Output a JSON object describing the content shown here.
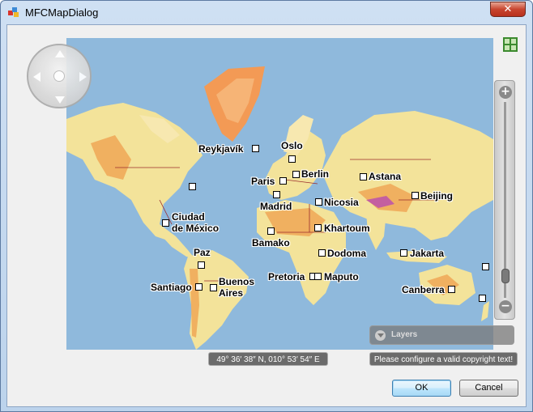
{
  "window": {
    "title": "MFCMapDialog",
    "close_symbol": "✕"
  },
  "map": {
    "cities": [
      {
        "id": "reykjavik",
        "label": "Reykjavík"
      },
      {
        "id": "oslo",
        "label": "Oslo"
      },
      {
        "id": "paris",
        "label": "Paris"
      },
      {
        "id": "berlin",
        "label": "Berlin"
      },
      {
        "id": "astana",
        "label": "Astana"
      },
      {
        "id": "madrid",
        "label": "Madrid"
      },
      {
        "id": "nicosia",
        "label": "Nicosia"
      },
      {
        "id": "beijing",
        "label": "Beijing"
      },
      {
        "id": "ciudad_de_mexico_1",
        "label": "Ciudad"
      },
      {
        "id": "ciudad_de_mexico_2",
        "label": "de México"
      },
      {
        "id": "khartoum",
        "label": "Khartoum"
      },
      {
        "id": "bamako",
        "label": "Bamako"
      },
      {
        "id": "paz",
        "label": "Paz"
      },
      {
        "id": "dodoma",
        "label": "Dodoma"
      },
      {
        "id": "jakarta",
        "label": "Jakarta"
      },
      {
        "id": "buenos_aires_1",
        "label": "Buenos"
      },
      {
        "id": "buenos_aires_2",
        "label": "Aires"
      },
      {
        "id": "pretoria",
        "label": "Pretoria"
      },
      {
        "id": "maputo",
        "label": "Maputo"
      },
      {
        "id": "santiago",
        "label": "Santiago"
      },
      {
        "id": "canberra",
        "label": "Canberra"
      }
    ],
    "colors": {
      "ocean": "#8fb9dc",
      "land": "#f3e39a",
      "highland": "#f0b060",
      "ice": "#f39a55",
      "border": "#9b2d2d"
    }
  },
  "controls": {
    "layers_label": "Layers",
    "coordinates": "49° 36′ 38″ N, 010° 53′ 54″ E",
    "copyright": "Please configure a valid copyright text!",
    "zoom_level_fraction": 0.08
  },
  "buttons": {
    "ok": "OK",
    "cancel": "Cancel"
  }
}
